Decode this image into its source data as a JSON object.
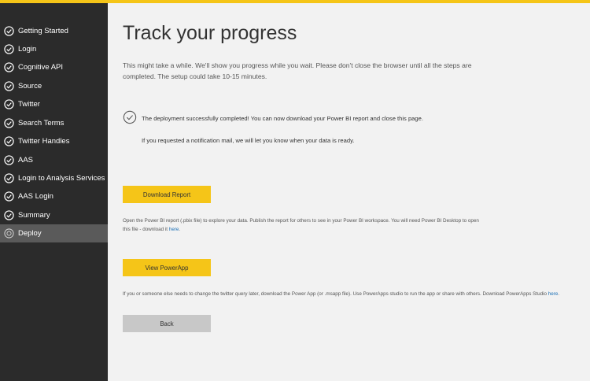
{
  "sidebar": {
    "items": [
      {
        "label": "Getting Started",
        "state": "done"
      },
      {
        "label": "Login",
        "state": "done"
      },
      {
        "label": "Cognitive API",
        "state": "done"
      },
      {
        "label": "Source",
        "state": "done"
      },
      {
        "label": "Twitter",
        "state": "done"
      },
      {
        "label": "Search Terms",
        "state": "done"
      },
      {
        "label": "Twitter Handles",
        "state": "done"
      },
      {
        "label": "AAS",
        "state": "done"
      },
      {
        "label": "Login to Analysis Services",
        "state": "done"
      },
      {
        "label": "AAS Login",
        "state": "done"
      },
      {
        "label": "Summary",
        "state": "done"
      },
      {
        "label": "Deploy",
        "state": "active"
      }
    ]
  },
  "main": {
    "title": "Track your progress",
    "intro": "This might take a while. We'll show you progress while you wait. Please don't close the browser until all the steps are completed. The setup could take 10-15 minutes.",
    "success_message": "The deployment successfully completed! You can now download your Power BI report and close this page.",
    "notify_message": "If you requested a notification mail, we will let you know when your data is ready.",
    "download_button": "Download Report",
    "download_desc": "Open the Power BI report (.pbix file) to explore your data. Publish the report for others to see in your Power BI workspace. You will need Power BI Desktop to open this file - download it ",
    "download_link": "here",
    "download_desc_end": ".",
    "powerapp_button": "View PowerApp",
    "powerapp_desc": "If you or someone else needs to change the twitter query later, download the Power App (or .msapp file). Use PowerApps studio to run the app or share with others. Download PowerApps Studio ",
    "powerapp_link": "here",
    "powerapp_desc_end": ".",
    "back_button": "Back"
  },
  "colors": {
    "accent": "#f5c518",
    "sidebar_bg": "#2b2b2b",
    "sidebar_active": "#5a5a5a",
    "page_bg": "#f2f2f2",
    "link": "#1a6fb5"
  },
  "icons": {
    "done": "check-circle-icon",
    "active": "progress-circle-icon",
    "success": "check-circle-icon"
  }
}
